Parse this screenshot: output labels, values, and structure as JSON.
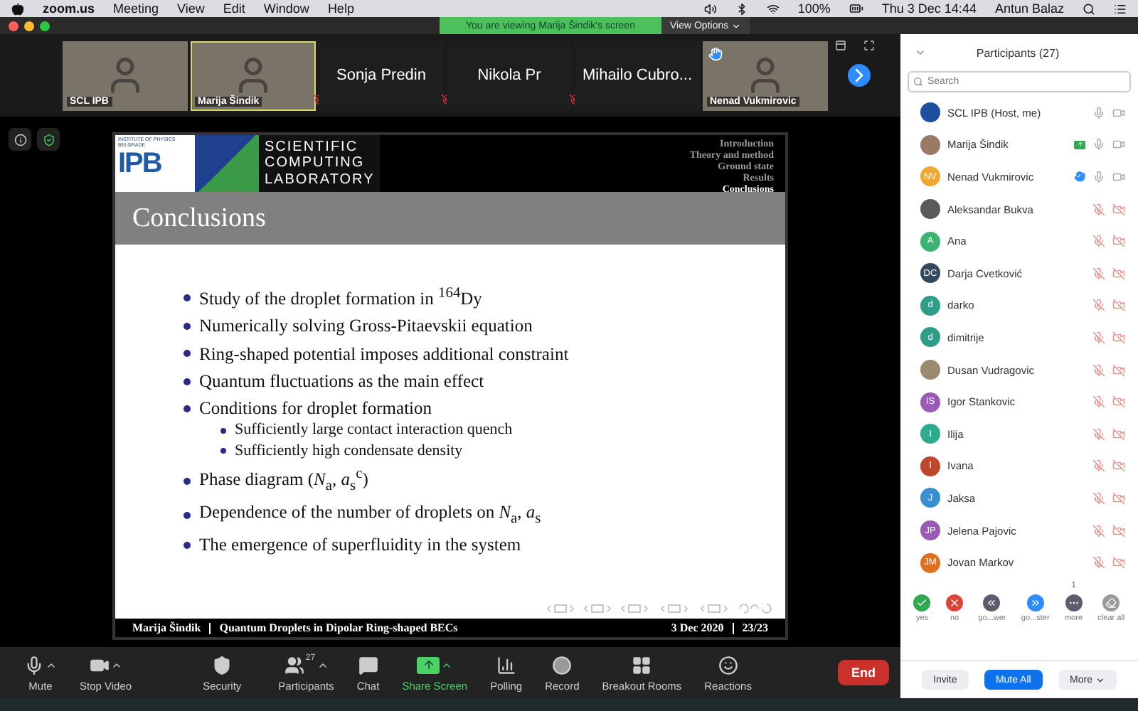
{
  "menubar": {
    "app": "zoom.us",
    "menus": [
      "Meeting",
      "View",
      "Edit",
      "Window",
      "Help"
    ],
    "battery": "100%",
    "clock": "Thu 3 Dec  14:44",
    "user": "Antun Balaz"
  },
  "window": {
    "banner": "You are viewing Marija Šindik's screen",
    "view_options": "View Options"
  },
  "video_strip": [
    {
      "name": "SCL IPB",
      "kind": "video",
      "active": false,
      "muted": false,
      "hand": false
    },
    {
      "name": "Marija Šindik",
      "kind": "video",
      "active": true,
      "muted": true,
      "hand": false
    },
    {
      "name": "Sonja Predin",
      "kind": "name",
      "active": false,
      "muted": true,
      "hand": false
    },
    {
      "name": "Nikola Pr",
      "kind": "name",
      "active": false,
      "muted": true,
      "hand": false
    },
    {
      "name": "Mihailo Cubro...",
      "kind": "name",
      "active": false,
      "muted": false,
      "hand": false
    },
    {
      "name": "Nenad Vukmirovic",
      "kind": "video",
      "active": false,
      "muted": false,
      "hand": true
    }
  ],
  "slide": {
    "logo": {
      "institute": "INSTITUTE OF PHYSICS",
      "city": "BELGRADE",
      "mark": "IPB",
      "lab": [
        "SCIENTIFIC",
        "COMPUTING",
        "LABORATORY"
      ]
    },
    "nav": [
      {
        "label": "Introduction",
        "selected": false
      },
      {
        "label": "Theory and method",
        "selected": false
      },
      {
        "label": "Ground state",
        "selected": false
      },
      {
        "label": "Results",
        "selected": false
      },
      {
        "label": "Conclusions",
        "selected": true
      }
    ],
    "title": "Conclusions",
    "bullets": [
      {
        "text": "Study of the droplet formation in $^{164}$Dy"
      },
      {
        "text": "Numerically solving Gross-Pitaevskii equation"
      },
      {
        "text": "Ring-shaped potential imposes additional constraint"
      },
      {
        "text": "Quantum fluctuations as the main effect"
      },
      {
        "text": "Conditions for droplet formation",
        "children": [
          {
            "text": "Sufficiently large contact interaction quench"
          },
          {
            "text": "Sufficiently high condensate density"
          }
        ]
      },
      {
        "text": "Phase diagram (*N*$_{a}$, *a*$_{s}$$^{c}$)"
      },
      {
        "text": "Dependence of the number of droplets on *N*$_{a}$, *a*$_{s}$"
      },
      {
        "text": "The emergence of superfluidity in the system"
      }
    ],
    "footer": {
      "author": "Marija Šindik",
      "talk": "Quantum Droplets in Dipolar Ring-shaped BECs",
      "date": "3 Dec 2020",
      "page": "23/23"
    }
  },
  "toolbar": [
    {
      "label": "Mute",
      "kind": "mic",
      "caret": true
    },
    {
      "label": "Stop Video",
      "kind": "video",
      "caret": true
    },
    {
      "label": "Security",
      "kind": "security",
      "caret": false
    },
    {
      "label": "Participants",
      "kind": "participants",
      "caret": true,
      "count": "27"
    },
    {
      "label": "Chat",
      "kind": "chat",
      "caret": false
    },
    {
      "label": "Share Screen",
      "kind": "share",
      "caret": true
    },
    {
      "label": "Polling",
      "kind": "polling",
      "caret": false
    },
    {
      "label": "Record",
      "kind": "record",
      "caret": false
    },
    {
      "label": "Breakout Rooms",
      "kind": "rooms",
      "caret": false
    },
    {
      "label": "Reactions",
      "kind": "reactions",
      "caret": false
    }
  ],
  "end_button": "End",
  "participants": {
    "title": "Participants (27)",
    "search": {
      "placeholder": "Search"
    },
    "items": [
      {
        "name": "SCL IPB (Host, me)",
        "kind": "logo",
        "color": "#1e4fa0",
        "mic_muted": false,
        "video_off": false,
        "sharing": false,
        "hand": false
      },
      {
        "name": "Marija Šindik",
        "kind": "photo",
        "color": "#9a7a66",
        "mic_muted": false,
        "video_off": false,
        "sharing": true,
        "hand": false
      },
      {
        "name": "Nenad Vukmirovic",
        "kind": "initials",
        "initials": "NV",
        "color": "#f0a830",
        "mic_muted": false,
        "video_off": false,
        "sharing": false,
        "hand": true
      },
      {
        "name": "Aleksandar Bukva",
        "kind": "photo",
        "color": "#5a5a58",
        "mic_muted": true,
        "video_off": true,
        "sharing": false,
        "hand": false
      },
      {
        "name": "Ana",
        "kind": "initials",
        "initials": "A",
        "color": "#3cb371",
        "mic_muted": true,
        "video_off": true,
        "sharing": false,
        "hand": false
      },
      {
        "name": "Darja Cvetković",
        "kind": "initials",
        "initials": "DC",
        "color": "#34495e",
        "mic_muted": true,
        "video_off": true,
        "sharing": false,
        "hand": false
      },
      {
        "name": "darko",
        "kind": "initials",
        "initials": "d",
        "color": "#2e9e88",
        "mic_muted": true,
        "video_off": true,
        "sharing": false,
        "hand": false
      },
      {
        "name": "dimitrije",
        "kind": "initials",
        "initials": "d",
        "color": "#2e9e88",
        "mic_muted": true,
        "video_off": true,
        "sharing": false,
        "hand": false
      },
      {
        "name": "Dusan Vudragovic",
        "kind": "photo",
        "color": "#9a8a70",
        "mic_muted": true,
        "video_off": true,
        "sharing": false,
        "hand": false
      },
      {
        "name": "Igor Stankovic",
        "kind": "initials",
        "initials": "IS",
        "color": "#9b59b6",
        "mic_muted": true,
        "video_off": true,
        "sharing": false,
        "hand": false
      },
      {
        "name": "Ilija",
        "kind": "initials",
        "initials": "I",
        "color": "#2eaa8e",
        "mic_muted": true,
        "video_off": true,
        "sharing": false,
        "hand": false
      },
      {
        "name": "Ivana",
        "kind": "initials",
        "initials": "I",
        "color": "#c0462c",
        "mic_muted": true,
        "video_off": true,
        "sharing": false,
        "hand": false
      },
      {
        "name": "Jaksa",
        "kind": "initials",
        "initials": "J",
        "color": "#3a8fd0",
        "mic_muted": true,
        "video_off": true,
        "sharing": false,
        "hand": false
      },
      {
        "name": "Jelena Pajovic",
        "kind": "initials",
        "initials": "JP",
        "color": "#9b59b6",
        "mic_muted": true,
        "video_off": true,
        "sharing": false,
        "hand": false
      },
      {
        "name": "Jovan Markov",
        "kind": "initials",
        "initials": "JM",
        "color": "#e07020",
        "mic_muted": true,
        "video_off": true,
        "sharing": false,
        "hand": false
      }
    ],
    "reactions": [
      {
        "label": "yes",
        "kind": "yes",
        "color": "#2fa84f"
      },
      {
        "label": "no",
        "kind": "no",
        "color": "#d9463a"
      },
      {
        "label": "go...wer",
        "kind": "slower",
        "color": "#5b5d6e"
      },
      {
        "label": "go...ster",
        "kind": "faster",
        "color": "#2d8cff"
      },
      {
        "label": "more",
        "kind": "more",
        "color": "#5b5d6e",
        "count": "1"
      },
      {
        "label": "clear all",
        "kind": "clear",
        "color": "#9a9a9a"
      }
    ],
    "buttons": [
      {
        "label": "Invite",
        "kind": "plain"
      },
      {
        "label": "Mute All",
        "kind": "primary"
      },
      {
        "label": "More",
        "kind": "menu"
      }
    ]
  }
}
